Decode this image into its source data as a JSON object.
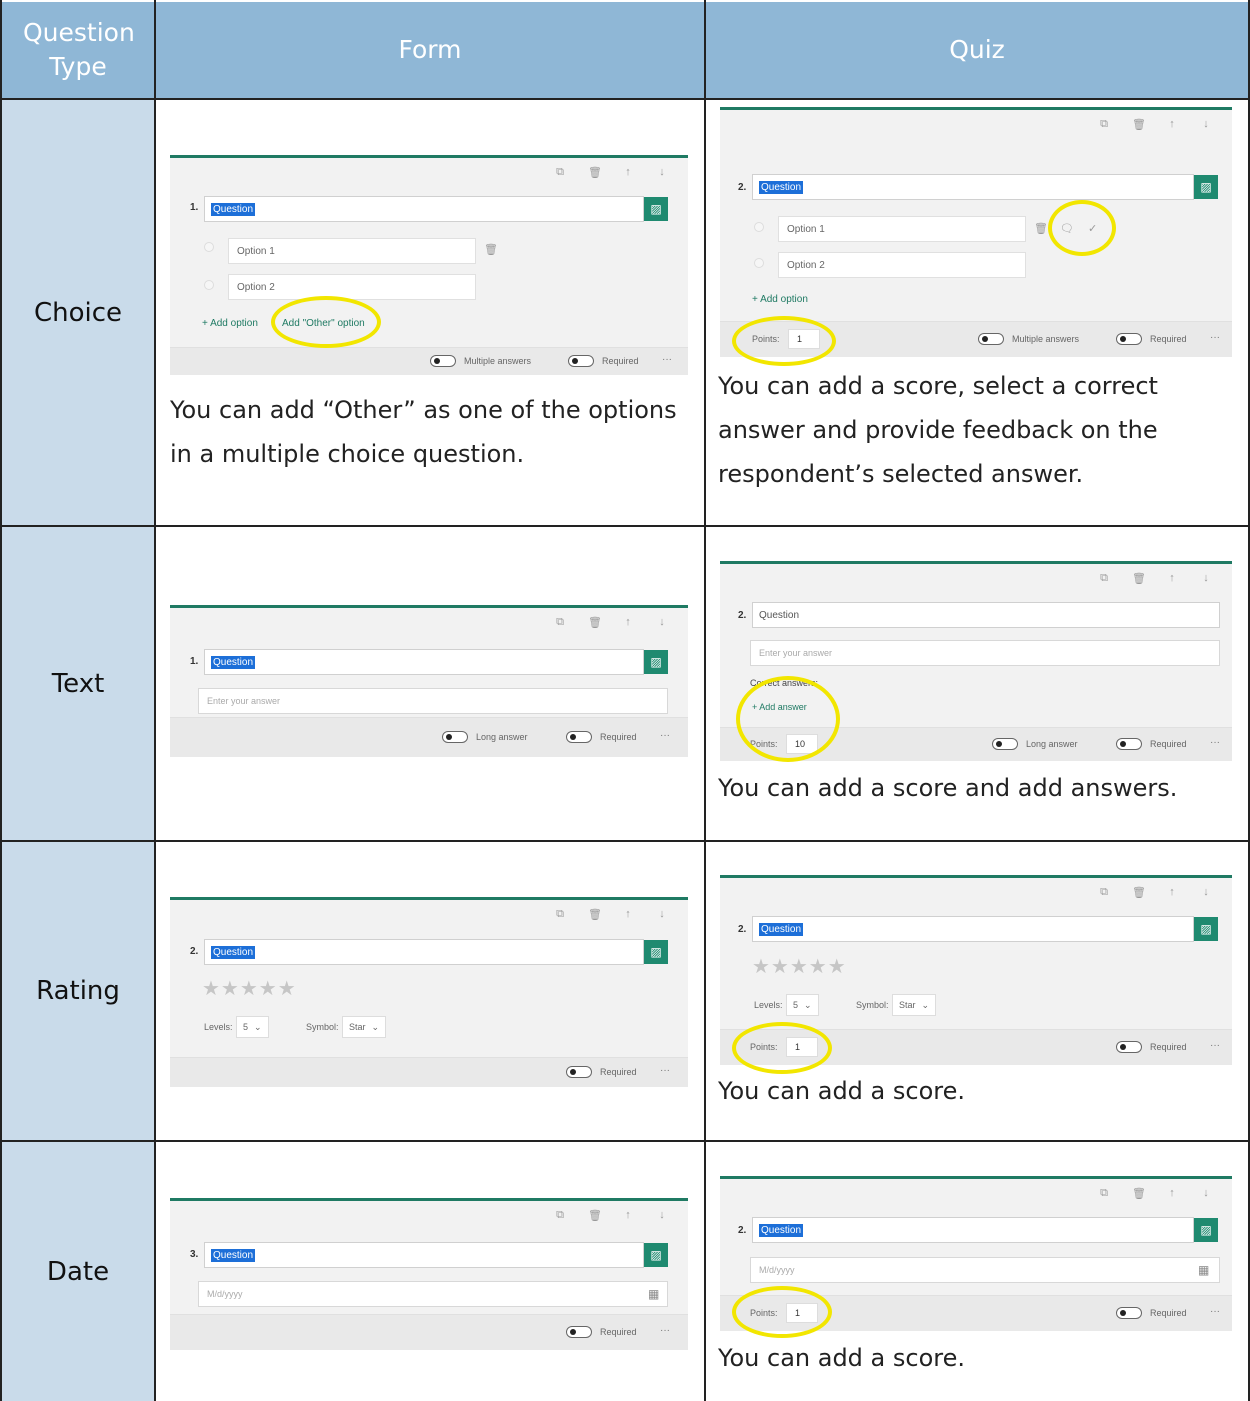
{
  "header": {
    "question_type": "Question Type",
    "form": "Form",
    "quiz": "Quiz"
  },
  "colors": {
    "header_bg": "#8fb7d6",
    "label_bg": "#c9dbea",
    "accent": "#1f7a63",
    "highlight": "#f2e600"
  },
  "icons": [
    "copy-icon",
    "delete-icon",
    "move-up-icon",
    "move-down-icon",
    "image-icon",
    "comment-icon",
    "check-icon",
    "calendar-icon",
    "more-icon"
  ],
  "rows": [
    {
      "label": "Choice",
      "form": {
        "qnum": "1.",
        "question": "Question",
        "options": [
          "Option 1",
          "Option 2"
        ],
        "add_option": "+ Add option",
        "add_other": "Add \"Other\" option",
        "toggle1": "Multiple answers",
        "toggle2": "Required",
        "more": "···",
        "caption": "You can add “Other” as one of the options in a multiple choice question."
      },
      "quiz": {
        "qnum": "2.",
        "question": "Question",
        "options": [
          "Option 1",
          "Option 2"
        ],
        "add_option": "+ Add option",
        "points_label": "Points:",
        "points": "1",
        "toggle1": "Multiple answers",
        "toggle2": "Required",
        "more": "···",
        "caption": "You can add a score, select a correct answer and provide feedback on the respondent’s selected answer."
      }
    },
    {
      "label": "Text",
      "form": {
        "qnum": "1.",
        "question": "Question",
        "answer_placeholder": "Enter your answer",
        "toggle1": "Long answer",
        "toggle2": "Required",
        "more": "···"
      },
      "quiz": {
        "qnum": "2.",
        "question": "Question",
        "answer_placeholder": "Enter your answer",
        "correct_answers": "Correct answers:",
        "add_answer": "+ Add answer",
        "points_label": "Points:",
        "points": "10",
        "toggle1": "Long answer",
        "toggle2": "Required",
        "more": "···",
        "caption": "You can add a score and add answers."
      }
    },
    {
      "label": "Rating",
      "form": {
        "qnum": "2.",
        "question": "Question",
        "stars": "★★★★★",
        "levels_label": "Levels:",
        "levels": "5",
        "symbol_label": "Symbol:",
        "symbol": "Star",
        "toggle2": "Required",
        "more": "···"
      },
      "quiz": {
        "qnum": "2.",
        "question": "Question",
        "stars": "★★★★★",
        "levels_label": "Levels:",
        "levels": "5",
        "symbol_label": "Symbol:",
        "symbol": "Star",
        "points_label": "Points:",
        "points": "1",
        "toggle2": "Required",
        "more": "···",
        "caption": "You can add a score."
      }
    },
    {
      "label": "Date",
      "form": {
        "qnum": "3.",
        "question": "Question",
        "date_placeholder": "M/d/yyyy",
        "toggle2": "Required",
        "more": "···"
      },
      "quiz": {
        "qnum": "2.",
        "question": "Question",
        "date_placeholder": "M/d/yyyy",
        "points_label": "Points:",
        "points": "1",
        "toggle2": "Required",
        "more": "···",
        "caption": "You can add a score."
      }
    }
  ]
}
